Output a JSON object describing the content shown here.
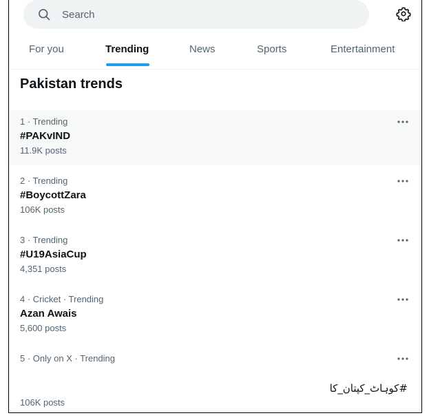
{
  "search": {
    "placeholder": "Search",
    "value": "",
    "icon": "search-icon"
  },
  "settings": {
    "icon": "gear-icon"
  },
  "tabs": [
    {
      "label": "For you",
      "active": false
    },
    {
      "label": "Trending",
      "active": true
    },
    {
      "label": "News",
      "active": false
    },
    {
      "label": "Sports",
      "active": false
    },
    {
      "label": "Entertainment",
      "active": false
    }
  ],
  "section": {
    "title": "Pakistan trends"
  },
  "colors": {
    "accent": "#1d9bf0",
    "primary_text": "#0f1419",
    "secondary_text": "#536471",
    "search_bg": "#eff3f4",
    "hover_bg": "#f7f9f9"
  },
  "trends": [
    {
      "meta": "1 · Trending",
      "name": "#PAKvIND",
      "posts": "11.9K posts",
      "more_icon": "more-icon"
    },
    {
      "meta": "2 · Trending",
      "name": "#BoycottZara",
      "posts": "106K posts",
      "more_icon": "more-icon"
    },
    {
      "meta": "3 · Trending",
      "name": "#U19AsiaCup",
      "posts": "4,351 posts",
      "more_icon": "more-icon"
    },
    {
      "meta": "4 · Cricket · Trending",
      "name": "Azan Awais",
      "posts": "5,600 posts",
      "more_icon": "more-icon"
    },
    {
      "meta": "5 · Only on X · Trending",
      "name": "#کوہاٹ_کپتان_کا",
      "posts": "106K posts",
      "more_icon": "more-icon"
    }
  ]
}
